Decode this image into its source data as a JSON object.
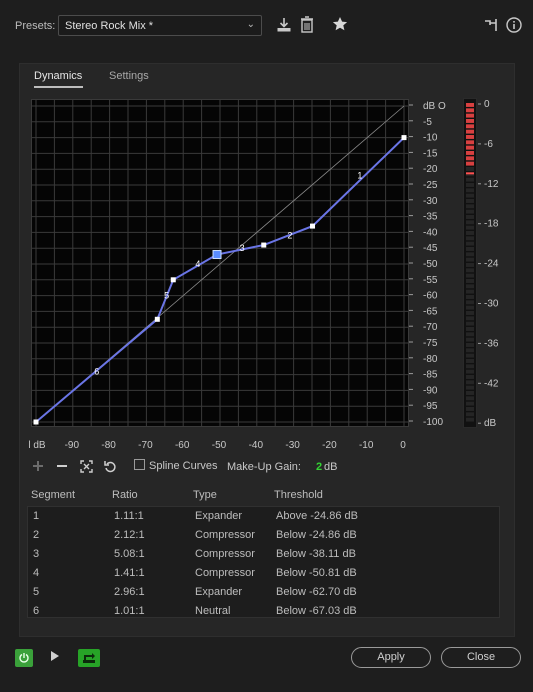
{
  "presets": {
    "label": "Presets:",
    "value": "Stereo Rock Mix *",
    "icons": [
      "download-icon",
      "trash-icon",
      "star-icon",
      "routing-icon",
      "info-icon"
    ]
  },
  "tabs": [
    {
      "label": "Dynamics",
      "active": true
    },
    {
      "label": "Settings",
      "active": false
    }
  ],
  "graph": {
    "x_ticks": [
      "l dB",
      "-90",
      "-80",
      "-70",
      "-60",
      "-50",
      "-40",
      "-30",
      "-20",
      "-10",
      "0"
    ],
    "y_ticks": [
      "dB O",
      "-5",
      "-10",
      "-15",
      "-20",
      "-25",
      "-30",
      "-35",
      "-40",
      "-45",
      "-50",
      "-55",
      "-60",
      "-65",
      "-70",
      "-75",
      "-80",
      "-85",
      "-90",
      "-95",
      "-100"
    ],
    "points": [
      {
        "in": -100,
        "out": -100
      },
      {
        "in": -67.03,
        "out": -67.5
      },
      {
        "in": -62.7,
        "out": -55
      },
      {
        "in": -50.81,
        "out": -47
      },
      {
        "in": -38.11,
        "out": -44
      },
      {
        "in": -24.86,
        "out": -38
      },
      {
        "in": 0,
        "out": -10
      }
    ],
    "selected_point_index": 3,
    "segment_labels": [
      {
        "label": "1",
        "in": -12,
        "out": -22
      },
      {
        "label": "2",
        "in": -31,
        "out": -41
      },
      {
        "label": "3",
        "in": -44,
        "out": -45
      },
      {
        "label": "4",
        "in": -56,
        "out": -50
      },
      {
        "label": "5",
        "in": -64.5,
        "out": -60
      },
      {
        "label": "6",
        "in": -83.5,
        "out": -84
      }
    ],
    "line_color": "#6a75e6"
  },
  "meter": {
    "labels": [
      "0",
      "-6",
      "-12",
      "-18",
      "-24",
      "-30",
      "-36",
      "-42",
      "dB"
    ],
    "level_fraction": 0.2
  },
  "toolbar": {
    "icons": [
      "add-point-icon",
      "remove-point-icon",
      "fit-icon",
      "reset-icon"
    ],
    "spline_label": "Spline Curves",
    "spline_checked": false,
    "makeup_label": "Make-Up Gain:",
    "makeup_value": "2",
    "makeup_unit": "dB"
  },
  "table": {
    "headers": [
      "Segment",
      "Ratio",
      "Type",
      "Threshold"
    ],
    "rows": [
      [
        "1",
        "1.11:1",
        "Expander",
        "Above -24.86 dB"
      ],
      [
        "2",
        "2.12:1",
        "Compressor",
        "Below -24.86 dB"
      ],
      [
        "3",
        "5.08:1",
        "Compressor",
        "Below -38.11 dB"
      ],
      [
        "4",
        "1.41:1",
        "Compressor",
        "Below -50.81 dB"
      ],
      [
        "5",
        "2.96:1",
        "Expander",
        "Below -62.70 dB"
      ],
      [
        "6",
        "1.01:1",
        "Neutral",
        "Below -67.03 dB"
      ]
    ]
  },
  "buttons": {
    "apply": "Apply",
    "close": "Close"
  },
  "colors": {
    "power": "#3aa13a",
    "makeup_value": "#33d233",
    "meter_red": "#d84040"
  }
}
